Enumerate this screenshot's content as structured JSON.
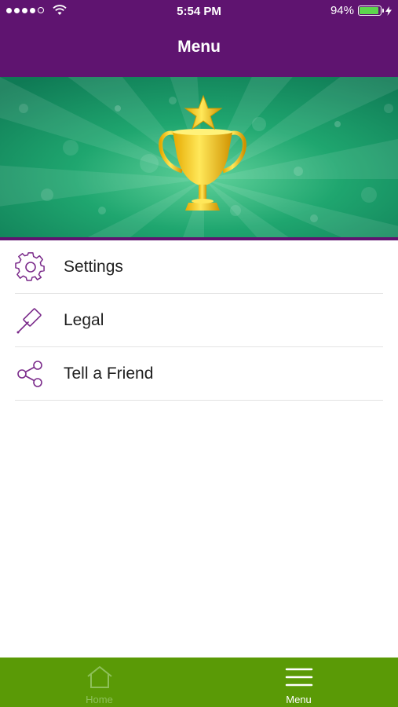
{
  "status_bar": {
    "time": "5:54 PM",
    "battery": "94%",
    "battery_level": 0.94
  },
  "nav": {
    "title": "Menu"
  },
  "menu_items": [
    {
      "label": "Settings",
      "icon": "gear-icon"
    },
    {
      "label": "Legal",
      "icon": "gavel-icon"
    },
    {
      "label": "Tell a Friend",
      "icon": "share-icon"
    }
  ],
  "tabs": [
    {
      "label": "Home",
      "icon": "home-icon",
      "active": false
    },
    {
      "label": "Menu",
      "icon": "hamburger-icon",
      "active": true
    }
  ],
  "colors": {
    "header": "#5f1470",
    "tabbar": "#5a9a06",
    "banner": "#17a06a",
    "icon": "#7a2a8a"
  }
}
